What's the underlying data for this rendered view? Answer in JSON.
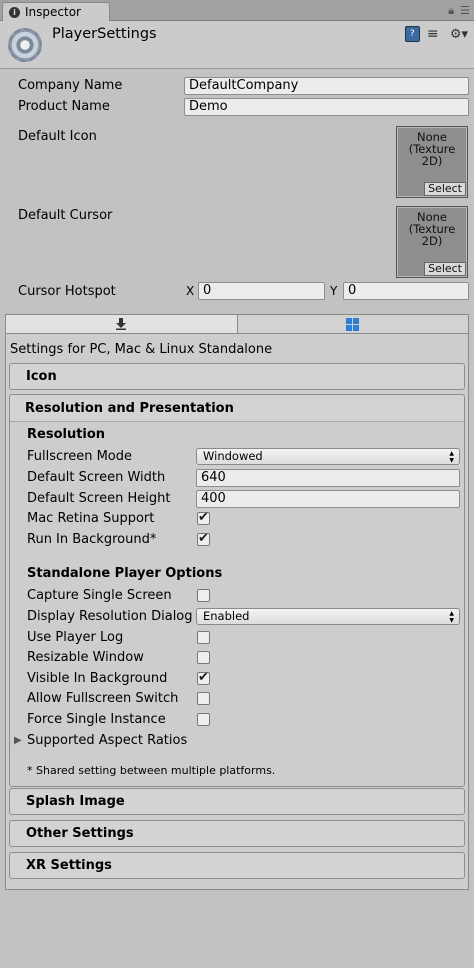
{
  "window": {
    "tab_title": "Inspector",
    "tab_icon": "info-icon",
    "lock_icon": "lock-icon",
    "menu_icon": "menu-icon"
  },
  "header": {
    "title": "PlayerSettings",
    "help_icon": "help-book-icon",
    "presets_icon": "presets-icon",
    "settings_icon": "gear-icon"
  },
  "fields": {
    "company_label": "Company Name",
    "company_value": "DefaultCompany",
    "product_label": "Product Name",
    "product_value": "Demo",
    "default_icon_label": "Default Icon",
    "default_cursor_label": "Default Cursor",
    "texture_none": "None",
    "texture_type": "(Texture",
    "texture_dim": "2D)",
    "select_label": "Select",
    "hotspot_label": "Cursor Hotspot",
    "hotspot_x_label": "X",
    "hotspot_x": "0",
    "hotspot_y_label": "Y",
    "hotspot_y": "0"
  },
  "platform_tabs": [
    {
      "icon": "download-icon",
      "active": true
    },
    {
      "icon": "windows-icon",
      "active": false
    }
  ],
  "platform_caption": "Settings for PC, Mac & Linux Standalone",
  "sections": {
    "icon": "Icon",
    "resolution": "Resolution and Presentation",
    "splash": "Splash Image",
    "other": "Other Settings",
    "xr": "XR Settings"
  },
  "resolution": {
    "heading": "Resolution",
    "fullscreen_label": "Fullscreen Mode",
    "fullscreen_value": "Windowed",
    "width_label": "Default Screen Width",
    "width_value": "640",
    "height_label": "Default Screen Height",
    "height_value": "400",
    "retina_label": "Mac Retina Support",
    "retina_checked": true,
    "background_label": "Run In Background*",
    "background_checked": true
  },
  "standalone": {
    "heading": "Standalone Player Options",
    "capture_label": "Capture Single Screen",
    "capture_checked": false,
    "dialog_label": "Display Resolution Dialog",
    "dialog_value": "Enabled",
    "log_label": "Use Player Log",
    "log_checked": false,
    "resizable_label": "Resizable Window",
    "resizable_checked": false,
    "visible_label": "Visible In Background",
    "visible_checked": true,
    "fullscreen_switch_label": "Allow Fullscreen Switch",
    "fullscreen_switch_checked": false,
    "single_instance_label": "Force Single Instance",
    "single_instance_checked": false,
    "aspect_label": "Supported Aspect Ratios"
  },
  "note": "* Shared setting between multiple platforms."
}
